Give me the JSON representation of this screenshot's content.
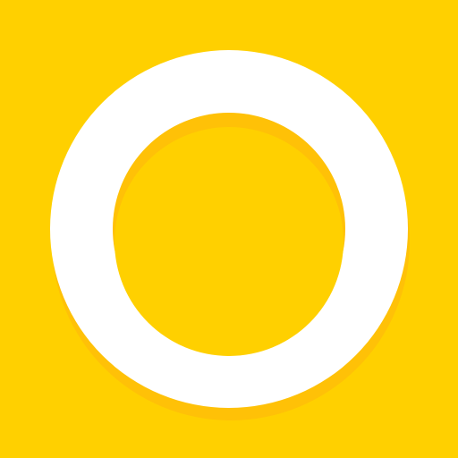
{
  "icon": {
    "name": "ring-logo-icon",
    "colors": {
      "background": "#FFD000",
      "ring": "#FFFFFF",
      "shadow": "#FFC107"
    }
  }
}
